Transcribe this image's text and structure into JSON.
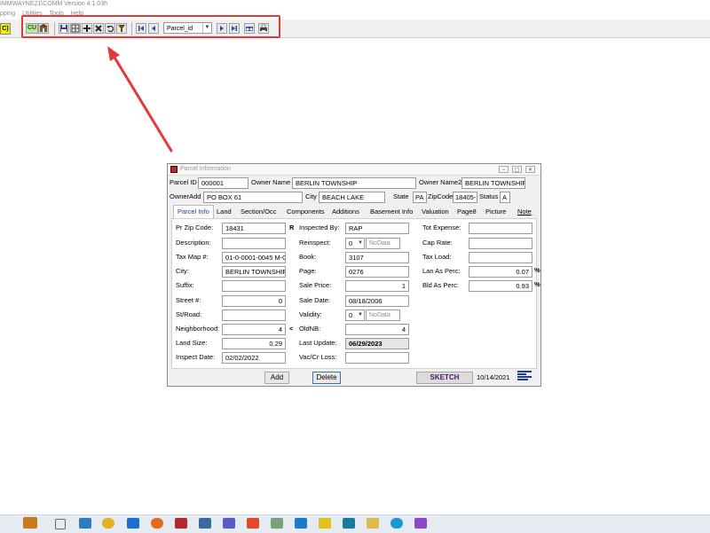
{
  "window_title": "IMMWAYNE21\\COMM Version 4.1.03h",
  "menu": [
    "pping",
    "Utilities",
    "Tools",
    "Help"
  ],
  "toolbar": {
    "c_badge": "C)",
    "cu_label": "CU",
    "search_field_value": "Parcel_id",
    "highlight_color": "#e53935"
  },
  "dialog": {
    "title": "Parcel Information",
    "header": {
      "parcel_id_label": "Parcel ID",
      "parcel_id": "000001",
      "owner_name_label": "Owner Name",
      "owner_name": "BERLIN TOWNSHIP",
      "owner_name2_label": "Owner Name2",
      "owner_name2": "BERLIN TOWNSHIF",
      "owner_add_label": "OwnerAdd",
      "owner_add": "PO BOX 61",
      "city_label": "City",
      "city": "BEACH LAKE",
      "state_label": "State",
      "state": "PA",
      "zip_label": "ZipCode",
      "zip": "18405-",
      "status_label": "Status",
      "status": "A"
    },
    "tabs": [
      "Parcel Info",
      "Land",
      "Section/Occ",
      "Components",
      "Additions",
      "Basement Info",
      "Valuation",
      "Page8",
      "Picture",
      "Note"
    ],
    "col1": {
      "pr_zip_label": "Pr Zip Code:",
      "pr_zip": "18431",
      "pr_zip_flag": "R",
      "description_label": "Description:",
      "description": "",
      "tax_map_label": "Tax Map #:",
      "tax_map": "01-0-0001-0045 M-0(",
      "city_label": "City:",
      "city": "BERLIN TOWNSHIP",
      "suffix_label": "Suffix:",
      "suffix": "",
      "street_no_label": "Street #:",
      "street_no": "0",
      "st_road_label": "St/Road:",
      "st_road": "",
      "neighborhood_label": "Neighborhood:",
      "neighborhood": "4",
      "neighborhood_flag": "<",
      "land_size_label": "Land Size:",
      "land_size": "0.29",
      "inspect_date_label": "Inspect Date:",
      "inspect_date": "02/02/2022"
    },
    "col2": {
      "inspected_by_label": "Inspected By:",
      "inspected_by": "RAP",
      "reinspect_label": "Reinspect:",
      "reinspect": "0",
      "reinspect_nodata": "NoData",
      "book_label": "Book:",
      "book": "3107",
      "page_label": "Page:",
      "page": "0276",
      "sale_price_label": "Sale Price:",
      "sale_price": "1",
      "sale_date_label": "Sale Date:",
      "sale_date": "08/18/2006",
      "validity_label": "Validity:",
      "validity": "0",
      "validity_nodata": "NoData",
      "oldnb_label": "OldNB:",
      "oldnb": "4",
      "last_update_label": "Last Update:",
      "last_update": "06/29/2023",
      "vac_cr_loss_label": "Vac/Cr Loss:",
      "vac_cr_loss": ""
    },
    "col3": {
      "tot_expense_label": "Tot Expense:",
      "tot_expense": "",
      "cap_rate_label": "Cap Rate:",
      "cap_rate": "",
      "tax_load_label": "Tax Load:",
      "tax_load": "",
      "lan_as_perc_label": "Lan As Perc:",
      "lan_as_perc": "0.07",
      "lan_pct_sign": "%",
      "bld_as_perc_label": "Bld As Perc:",
      "bld_as_perc": "0.93",
      "bld_pct_sign": "%"
    },
    "footer": {
      "add_label": "Add",
      "delete_label": "Delete",
      "sketch_label": "SKETCH",
      "date": "10/14/2021"
    }
  },
  "taskbar_icons": [
    "briefcase-icon",
    "task-view-icon",
    "file-manager-icon",
    "chrome-icon",
    "outlook-icon",
    "firefox-icon",
    "access-icon",
    "app-icon",
    "teams-icon",
    "s-app-icon",
    "app-icon",
    "vscode-icon",
    "sticky-notes-icon",
    "app-icon",
    "explorer-icon",
    "edge-icon",
    "app-icon"
  ]
}
